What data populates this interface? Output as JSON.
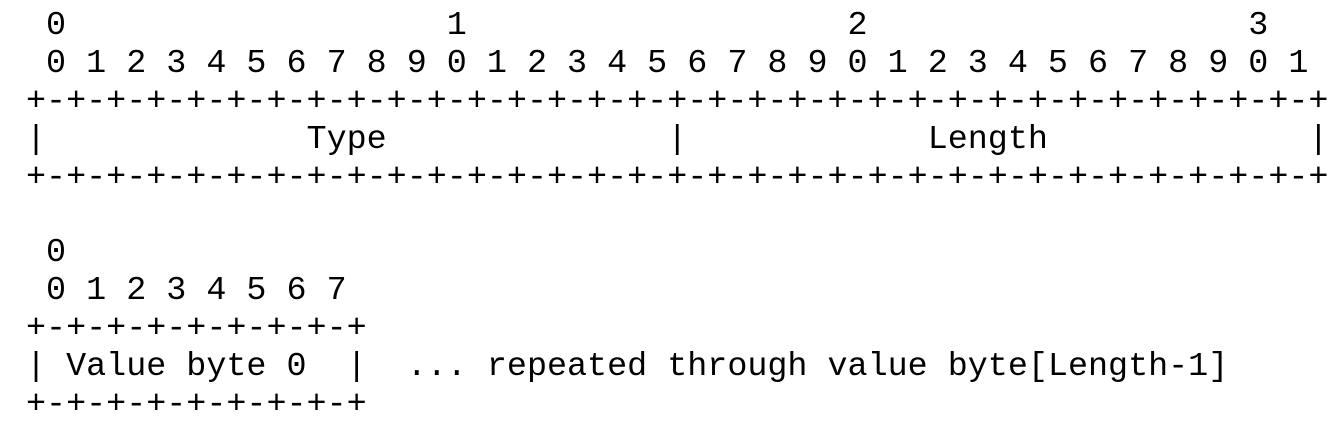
{
  "header_diagram": {
    "tens_row": " 0                   1                   2                   3",
    "ones_row": " 0 1 2 3 4 5 6 7 8 9 0 1 2 3 4 5 6 7 8 9 0 1 2 3 4 5 6 7 8 9 0 1",
    "border_top": "+-+-+-+-+-+-+-+-+-+-+-+-+-+-+-+-+-+-+-+-+-+-+-+-+-+-+-+-+-+-+-+-+",
    "fields_row": "|             Type              |            Length             |",
    "border_bottom": "+-+-+-+-+-+-+-+-+-+-+-+-+-+-+-+-+-+-+-+-+-+-+-+-+-+-+-+-+-+-+-+-+"
  },
  "value_diagram": {
    "tens_row": " 0",
    "ones_row": " 0 1 2 3 4 5 6 7",
    "border_top": "+-+-+-+-+-+-+-+-+",
    "fields_row": "| Value byte 0  |  ... repeated through value byte[Length-1]",
    "border_bottom": "+-+-+-+-+-+-+-+-+"
  }
}
